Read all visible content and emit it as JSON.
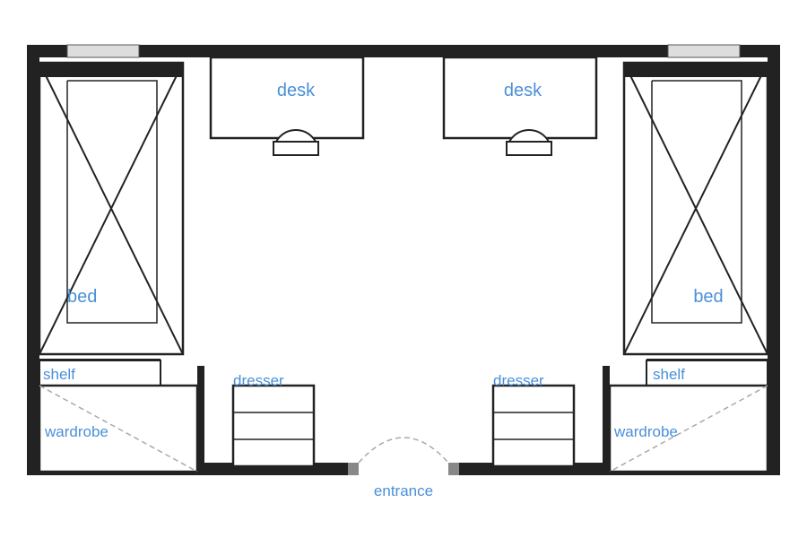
{
  "labels": {
    "bed_left": "bed",
    "bed_right": "bed",
    "desk_left": "desk",
    "desk_right": "desk",
    "shelf_left": "shelf",
    "shelf_right": "shelf",
    "wardrobe_left": "wardrobe",
    "wardrobe_right": "wardrobe",
    "dresser_left": "dresser",
    "dresser_right": "dresser",
    "entrance": "entrance"
  },
  "colors": {
    "label_blue": "#4a90d9",
    "wall": "#222222",
    "background": "#ffffff"
  }
}
